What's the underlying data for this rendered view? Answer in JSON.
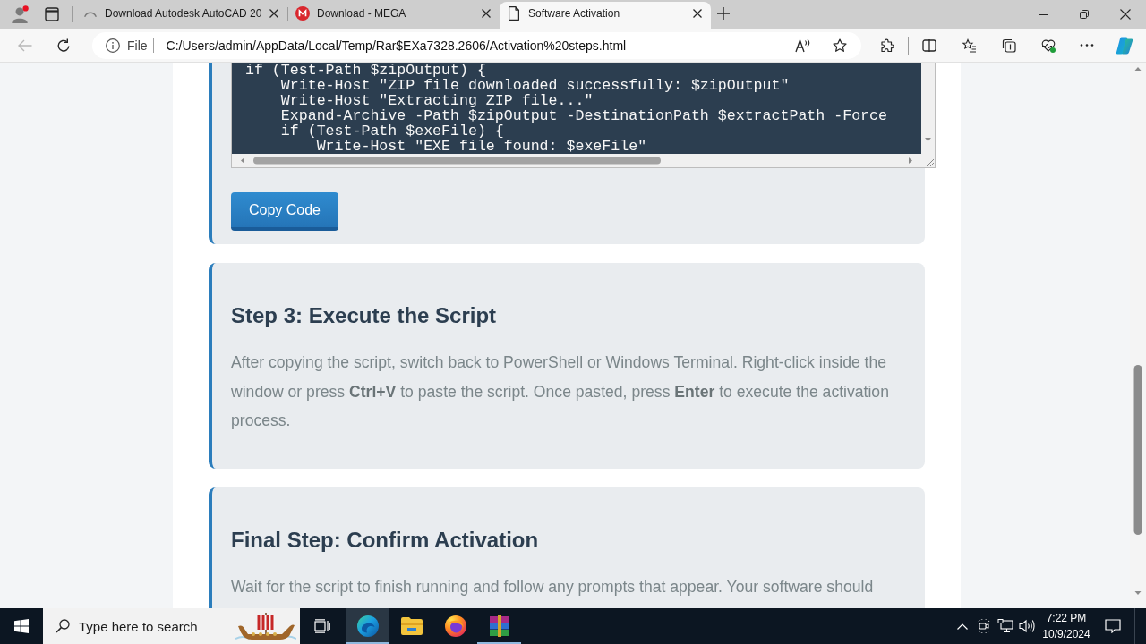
{
  "browser": {
    "tabs": [
      {
        "kind": "loading",
        "title": "Download Autodesk AutoCAD 20",
        "selected": false
      },
      {
        "kind": "mega",
        "title": "Download - MEGA",
        "selected": false
      },
      {
        "kind": "page",
        "title": "Software Activation",
        "selected": true
      }
    ],
    "back_button": {
      "disabled": true
    },
    "address_bar": {
      "scheme": "File",
      "url": "C:/Users/admin/AppData/Local/Temp/Rar$EXa7328.2606/Activation%20steps.html"
    }
  },
  "page": {
    "code_block": {
      "lines": [
        "if (Test-Path $zipOutput) {",
        "    Write-Host \"ZIP file downloaded successfully: $zipOutput\"",
        "    Write-Host \"Extracting ZIP file...\"",
        "    Expand-Archive -Path $zipOutput -DestinationPath $extractPath -Force",
        "    if (Test-Path $exeFile) {",
        "        Write-Host \"EXE file found: $exeFile\""
      ]
    },
    "copy_button": "Copy Code",
    "sections": [
      {
        "heading": "Step 3: Execute the Script",
        "text": "After copying the script, switch back to PowerShell or Windows Terminal. Right-click inside the window or press **Ctrl+V** to paste the script. Once pasted, press **Enter** to execute the activation process."
      },
      {
        "heading": "Final Step: Confirm Activation",
        "text": "Wait for the script to finish running and follow any prompts that appear. Your software should"
      }
    ]
  },
  "taskbar": {
    "search": {
      "placeholder": "Type here to search"
    },
    "apps": [
      {
        "kind": "edge",
        "selected": true,
        "running": true
      },
      {
        "kind": "explorer",
        "selected": false,
        "running": false
      },
      {
        "kind": "firefox",
        "selected": false,
        "running": false
      },
      {
        "kind": "winrar",
        "selected": false,
        "running": true
      }
    ],
    "clock": {
      "time": "7:22 PM",
      "date": "10/9/2024"
    }
  }
}
